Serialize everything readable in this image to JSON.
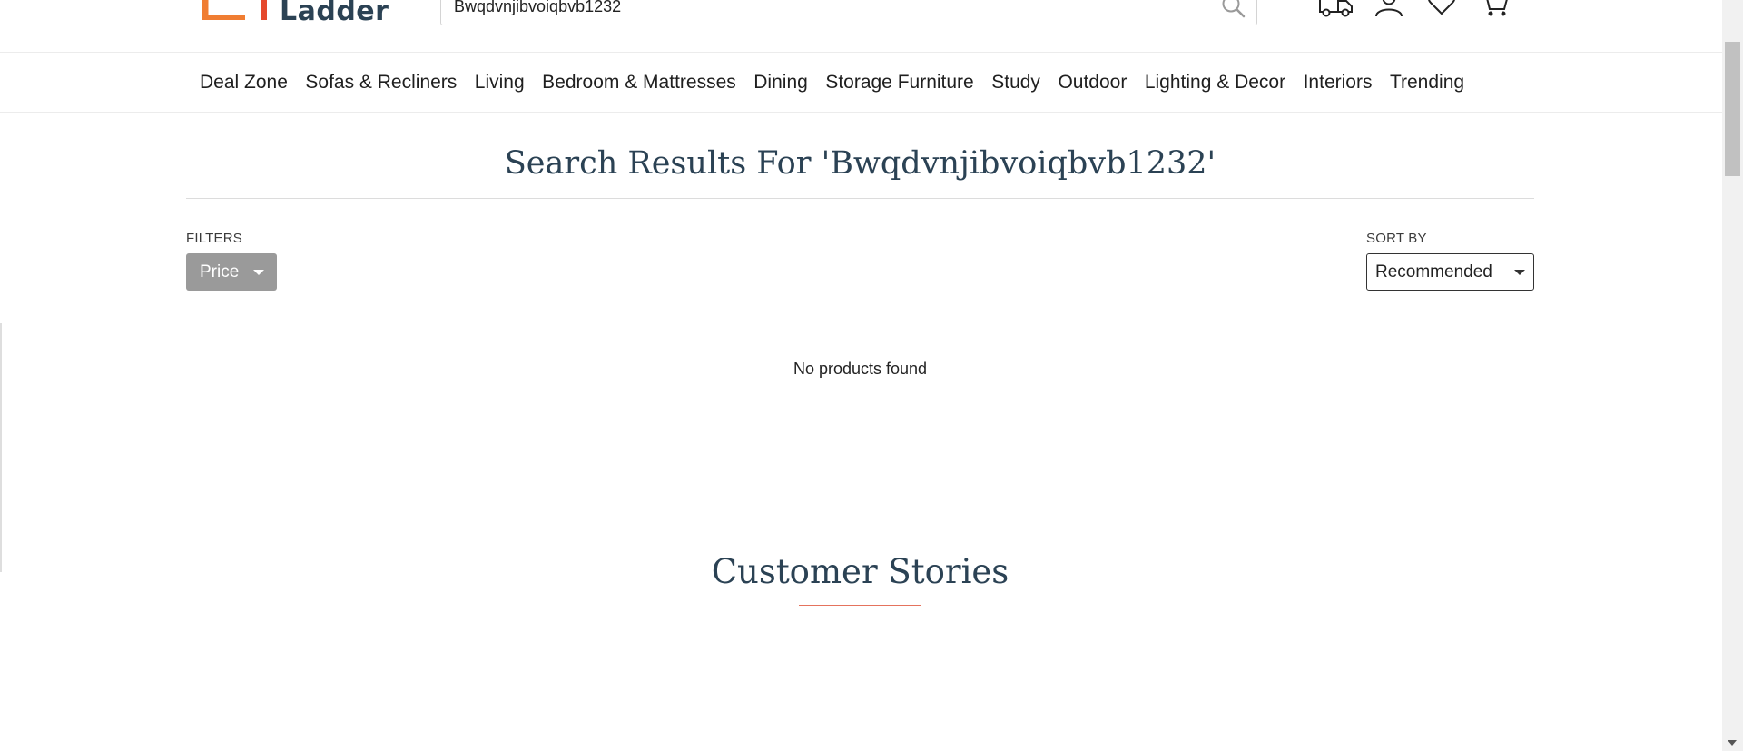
{
  "brand": {
    "logo_text": "Ladder",
    "accent_orange": "#f07d32",
    "accent_red": "#e5492c",
    "text_navy": "#2b4254"
  },
  "search": {
    "value": "Bwqdvnjibvoiqbvb1232",
    "placeholder": "",
    "icon": "search-icon"
  },
  "header_icons": [
    {
      "name": "track-order-icon"
    },
    {
      "name": "account-icon"
    },
    {
      "name": "wishlist-icon"
    },
    {
      "name": "cart-icon"
    }
  ],
  "nav": {
    "items": [
      "Deal Zone",
      "Sofas & Recliners",
      "Living",
      "Bedroom & Mattresses",
      "Dining",
      "Storage Furniture",
      "Study",
      "Outdoor",
      "Lighting & Decor",
      "Interiors",
      "Trending"
    ]
  },
  "results": {
    "title": "Search Results For 'Bwqdvnjibvoiqbvb1232'",
    "filters_label": "FILTERS",
    "price_filter_label": "Price",
    "sort_label": "SORT BY",
    "sort_selected": "Recommended",
    "empty_message": "No products found"
  },
  "stories": {
    "title": "Customer Stories",
    "rule_color": "#e5735d"
  }
}
